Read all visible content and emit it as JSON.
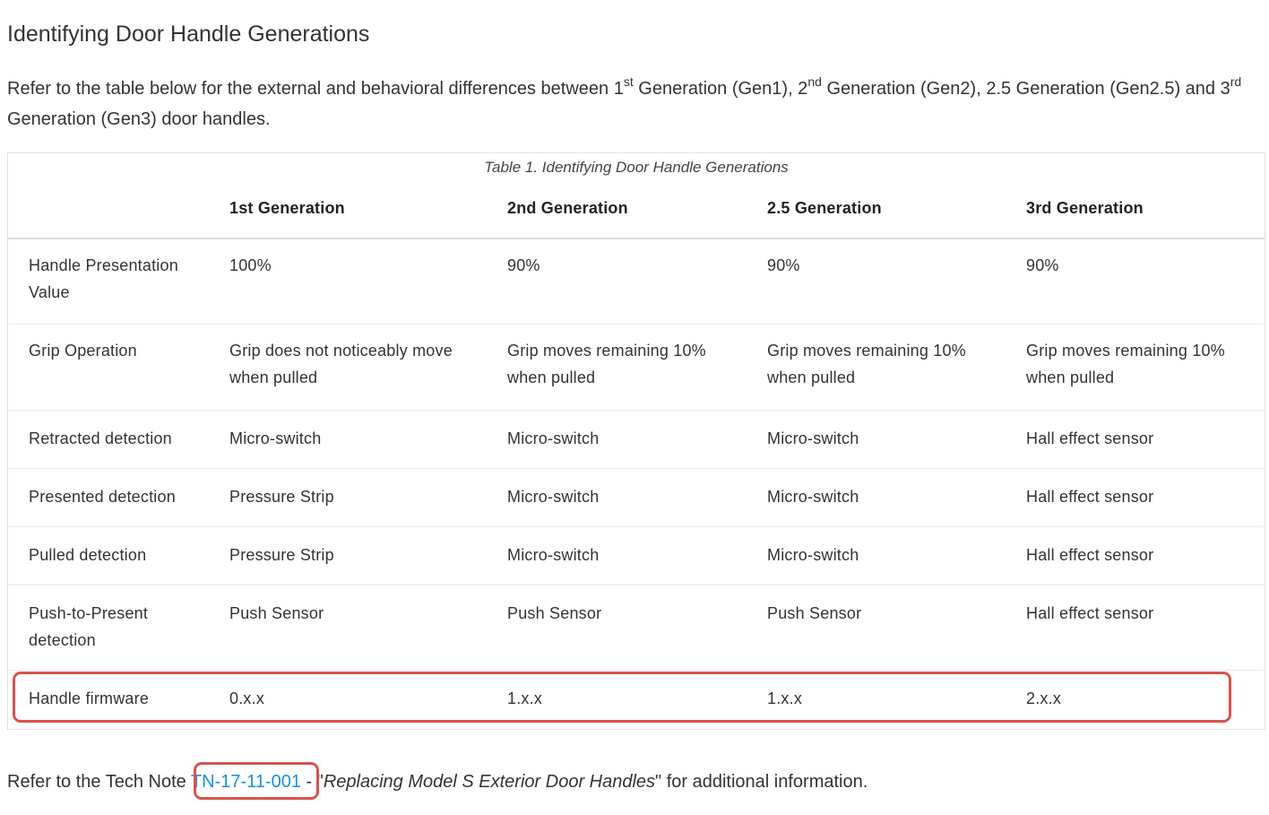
{
  "heading": "Identifying Door Handle Generations",
  "intro": {
    "t1": "Refer to the table below for the external and behavioral differences between 1",
    "s1": "st",
    "t2": " Generation (Gen1), 2",
    "s2": "nd",
    "t3": " Generation (Gen2), 2.5 Generation (Gen2.5) and 3",
    "s3": "rd",
    "t4": " Generation (Gen3) door handles."
  },
  "table": {
    "caption": "Table 1. Identifying Door Handle Generations",
    "headers": [
      "",
      "1st Generation",
      "2nd Generation",
      "2.5 Generation",
      "3rd Generation"
    ],
    "rows": [
      [
        "Handle Presentation Value",
        "100%",
        "90%",
        "90%",
        "90%"
      ],
      [
        "Grip Operation",
        "Grip does not noticeably move when pulled",
        "Grip moves remaining 10% when pulled",
        "Grip moves remaining 10% when pulled",
        "Grip moves remaining 10% when pulled"
      ],
      [
        "Retracted detection",
        "Micro-switch",
        "Micro-switch",
        "Micro-switch",
        "Hall effect sensor"
      ],
      [
        "Presented detection",
        "Pressure Strip",
        "Micro-switch",
        "Micro-switch",
        "Hall effect sensor"
      ],
      [
        "Pulled detection",
        "Pressure Strip",
        "Micro-switch",
        "Micro-switch",
        "Hall effect sensor"
      ],
      [
        "Push-to-Present detection",
        "Push Sensor",
        "Push Sensor",
        "Push Sensor",
        "Hall effect sensor"
      ],
      [
        "Handle firmware",
        "0.x.x",
        "1.x.x",
        "1.x.x",
        "2.x.x"
      ]
    ]
  },
  "footer": {
    "prefix": "Refer to the Tech Note ",
    "link": "TN-17-11-001",
    "mid": " - \"",
    "title": "Replacing Model S Exterior Door Handles",
    "suffix": "\" for additional information."
  },
  "colors": {
    "highlight": "#d9534f",
    "link": "#1a8fd8"
  }
}
